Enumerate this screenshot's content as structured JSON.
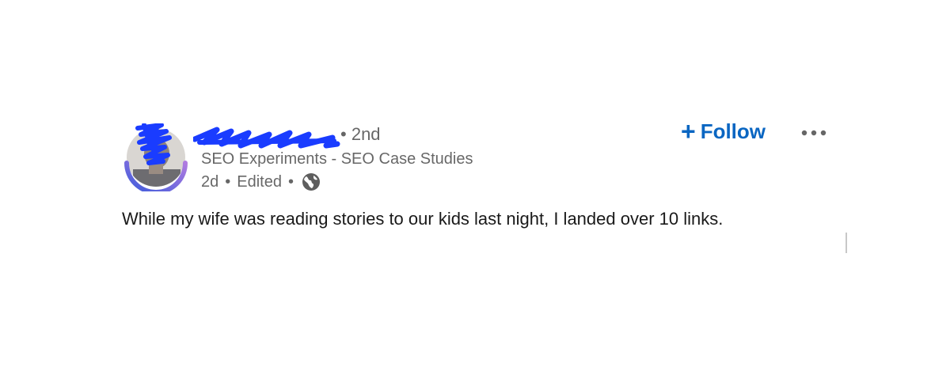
{
  "post": {
    "author": {
      "degree": "2nd",
      "headline": "SEO Experiments - SEO Case Studies",
      "time": "2d",
      "edited": "Edited",
      "separator": "•",
      "avatar_ring_color": "#a77dd6",
      "avatar_ring_color_2": "#3b5bdb",
      "redaction_color": "#1a3cff"
    },
    "actions": {
      "follow_plus": "+",
      "follow_label": "Follow",
      "follow_color": "#0a66c2"
    },
    "icons": {
      "visibility": "globe-icon",
      "menu": "more-options-icon"
    },
    "text": "While my wife was reading stories to our kids last night, I landed over 10 links."
  }
}
